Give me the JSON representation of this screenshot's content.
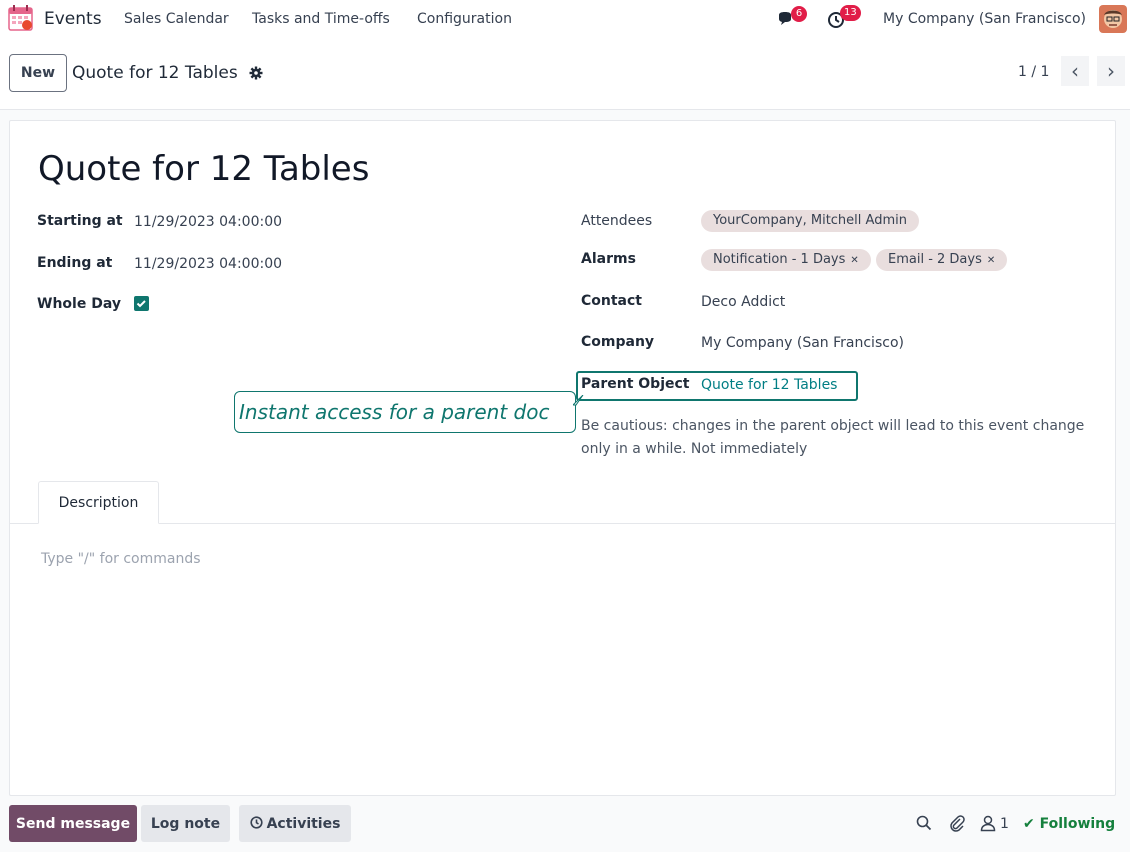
{
  "nav": {
    "app_name": "Events",
    "menu": [
      "Sales Calendar",
      "Tasks and Time-offs",
      "Configuration"
    ],
    "messages_badge": "6",
    "activities_badge": "13",
    "company": "My Company (San Francisco)"
  },
  "control": {
    "new_label": "New",
    "record_title": "Quote for 12 Tables",
    "pager": "1 / 1"
  },
  "form": {
    "title": "Quote for 12 Tables",
    "starting_label": "Starting at",
    "starting_value": "11/29/2023 04:00:00",
    "ending_label": "Ending at",
    "ending_value": "11/29/2023 04:00:00",
    "whole_day_label": "Whole Day",
    "whole_day_checked": true,
    "attendees_label": "Attendees",
    "attendees": [
      "YourCompany, Mitchell Admin"
    ],
    "alarms_label": "Alarms",
    "alarms": [
      "Notification - 1 Days",
      "Email - 2 Days"
    ],
    "contact_label": "Contact",
    "contact_value": "Deco Addict",
    "company_label": "Company",
    "company_value": "My Company (San Francisco)",
    "parent_label": "Parent Object",
    "parent_value": "Quote for 12 Tables",
    "warning": "Be cautious: changes in the parent object will lead to this event change only in a while. Not immediately",
    "callout": "Instant access for a parent doc"
  },
  "tabs": {
    "description": "Description",
    "placeholder": "Type \"/\" for commands"
  },
  "chatter": {
    "send_message": "Send message",
    "log_note": "Log note",
    "activities": "Activities",
    "followers": "1",
    "following": "Following"
  },
  "colors": {
    "primary": "#714b67",
    "accent": "#0f766e",
    "link": "#017e84",
    "badge": "#e11d48",
    "following": "#15803d"
  }
}
